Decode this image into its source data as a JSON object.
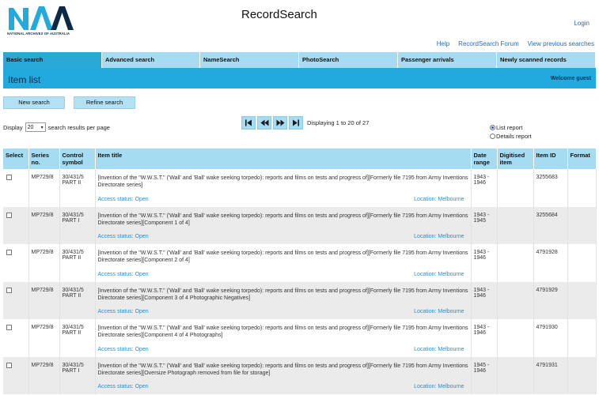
{
  "logo": {
    "letters": "NAA",
    "subtitle": "NATIONAL ARCHIVES OF AUSTRALIA"
  },
  "header": {
    "title": "RecordSearch",
    "login": "Login"
  },
  "top_links": [
    "Help",
    "RecordSearch Forum",
    "View previous searches"
  ],
  "tabs": [
    {
      "label": "Basic search",
      "active": true
    },
    {
      "label": "Advanced search",
      "active": false
    },
    {
      "label": "NameSearch",
      "active": false
    },
    {
      "label": "PhotoSearch",
      "active": false
    },
    {
      "label": "Passenger arrivals",
      "active": false
    },
    {
      "label": "Newly scanned records",
      "active": false
    }
  ],
  "banner": {
    "title": "Item list",
    "welcome": "Welcome guest"
  },
  "buttons": {
    "new_search": "New search",
    "refine_search": "Refine search"
  },
  "results": {
    "display_label": "Display",
    "per_page_value": "20",
    "per_page_suffix": "search results per page",
    "displaying": "Displaying 1 to 20 of 27"
  },
  "report_options": {
    "list": "List report",
    "details": "Details report",
    "selected": "list"
  },
  "table": {
    "headers": {
      "select": "Select",
      "series": "Series no.",
      "control": "Control symbol",
      "title": "Item title",
      "date": "Date range",
      "digitised": "Digitised item",
      "item_id": "Item ID",
      "format": "Format"
    },
    "rows": [
      {
        "series": "MP729/8",
        "control": "30/431/5 PART II",
        "title": "[Invention of the \"W.W.S.T.\" ('Wall' and 'Ball' wake seeking torpedo): reports and films on tests and progress of][Formerly file 7195 from Army Inventions Directorate series]",
        "access": "Access status: Open",
        "location": "Location: Melbourne",
        "date": "1943 - 1946",
        "item_id": "3255683"
      },
      {
        "series": "MP729/8",
        "control": "30/431/5 PART I",
        "title": "[Invention of the \"W.W.S.T.\" ('Wall' and 'Ball' wake seeking torpedo): reports and films on tests and progress of][Formerly file 7195 from Army Inventions Directorate series][Component 1 of 4]",
        "access": "Access status: Open",
        "location": "Location: Melbourne",
        "date": "1943 - 1945",
        "item_id": "3255684"
      },
      {
        "series": "MP729/8",
        "control": "30/431/5 PART II",
        "title": "[Invention of the \"W.W.S.T.\" ('Wall' and 'Ball' wake seeking torpedo): reports and films on tests and progress of][Formerly file 7195 from Army Inventions Directorate series][Component 2 of 4]",
        "access": "Access status: Open",
        "location": "Location: Melbourne",
        "date": "1943 - 1946",
        "item_id": "4791928"
      },
      {
        "series": "MP729/8",
        "control": "30/431/5 PART II",
        "title": "[Invention of the \"W.W.S.T.\" ('Wall' and 'Ball' wake seeking torpedo): reports and films on tests and progress of][Formerly file 7195 from Army Inventions Directorate series][Component 3 of 4 Photographic Negatives]",
        "access": "Access status: Open",
        "location": "Location: Melbourne",
        "date": "1943 - 1946",
        "item_id": "4791929"
      },
      {
        "series": "MP729/8",
        "control": "30/431/5 PART II",
        "title": "[Invention of the \"W.W.S.T.\" ('Wall' and 'Ball' wake seeking torpedo): reports and films on tests and progress of][Formerly file 7195 from Army Inventions Directorate series][Component 4 of 4 Photographs]",
        "access": "Access status: Open",
        "location": "Location: Melbourne",
        "date": "1943 - 1946",
        "item_id": "4791930"
      },
      {
        "series": "MP729/8",
        "control": "30/431/5 PART I",
        "title": "[Invention of the \"W.W.S.T.\" ('Wall' and 'Ball' wake seeking torpedo): reports and films on tests and progress of][Formerly file 7195 from Army Inventions Directorate series][Oversize Photograph removed from file for storage]",
        "access": "Access status: Open",
        "location": "Location: Melbourne",
        "date": "1945 - 1946",
        "item_id": "4791931"
      }
    ]
  },
  "colors": {
    "tab": "#a6dcf2",
    "tab_active": "#2aa8d8",
    "banner": "#22aadf",
    "link": "#2a6ab3"
  }
}
